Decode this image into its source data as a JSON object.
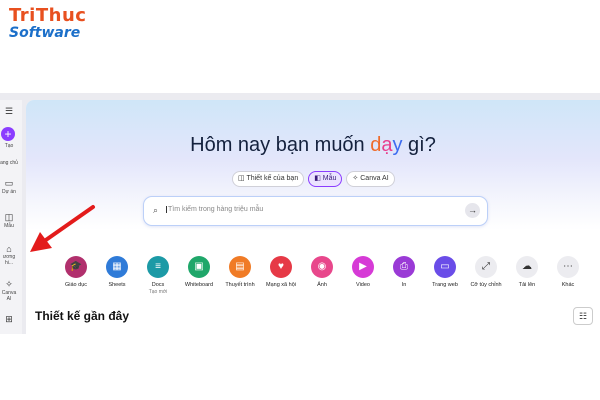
{
  "watermark": {
    "line1": "TriThuc",
    "line2": "Software"
  },
  "sidebar": {
    "items": [
      {
        "label": "",
        "icon": "menu-icon"
      },
      {
        "label": "Tạo",
        "icon": "plus-icon"
      },
      {
        "label": "ang chủ",
        "icon": "home-icon"
      },
      {
        "label": "Dự án",
        "icon": "folder-icon"
      },
      {
        "label": "Mẫu",
        "icon": "template-icon"
      },
      {
        "label": "ương hi...",
        "icon": "brand-icon"
      },
      {
        "label": "Canva AI",
        "icon": "sparkle-icon"
      },
      {
        "label": "",
        "icon": "apps-icon"
      }
    ]
  },
  "hero": {
    "title_pre": "Hôm nay bạn muốn ",
    "title_d": "d",
    "title_a": "ạ",
    "title_y": "y",
    "title_post": " gì?"
  },
  "tabs": [
    {
      "label": "Thiết kế của bạn",
      "icon": "◫",
      "active": false
    },
    {
      "label": "Mẫu",
      "icon": "◧",
      "active": true
    },
    {
      "label": "Canva AI",
      "icon": "✧",
      "active": false
    }
  ],
  "search": {
    "placeholder": "Tìm kiếm trong hàng triệu mẫu",
    "icon": "search-icon",
    "submit_icon": "arrow-right-icon"
  },
  "categories": [
    {
      "label": "Giáo dục",
      "sub": "",
      "color": "#b1306d",
      "glyph": "🎓"
    },
    {
      "label": "Sheets",
      "sub": "",
      "color": "#2f7bd8",
      "glyph": "▦"
    },
    {
      "label": "Docs",
      "sub": "Tạo mới",
      "color": "#1c9aa6",
      "glyph": "≡"
    },
    {
      "label": "Whiteboard",
      "sub": "",
      "color": "#1fa76a",
      "glyph": "▣"
    },
    {
      "label": "Thuyết trình",
      "sub": "",
      "color": "#f07b26",
      "glyph": "▤"
    },
    {
      "label": "Mạng xã hội",
      "sub": "",
      "color": "#e63946",
      "glyph": "♥"
    },
    {
      "label": "Ảnh",
      "sub": "",
      "color": "#e8478b",
      "glyph": "◉"
    },
    {
      "label": "Video",
      "sub": "",
      "color": "#d63ad6",
      "glyph": "▶"
    },
    {
      "label": "In",
      "sub": "",
      "color": "#9a3ad6",
      "glyph": "⎙"
    },
    {
      "label": "Trang web",
      "sub": "",
      "color": "#6a4de8",
      "glyph": "▭"
    },
    {
      "label": "Cỡ tùy chỉnh",
      "sub": "",
      "color": "#ececf0",
      "glyph": "⤢"
    },
    {
      "label": "Tải lên",
      "sub": "",
      "color": "#ececf0",
      "glyph": "☁"
    },
    {
      "label": "Khác",
      "sub": "",
      "color": "#ececf0",
      "glyph": "⋯"
    }
  ],
  "recent": {
    "title": "Thiết kế gần đây",
    "view_icon": "list-view-icon"
  },
  "colors": {
    "accent": "#8b3dff",
    "arrow": "#e31b1b"
  }
}
